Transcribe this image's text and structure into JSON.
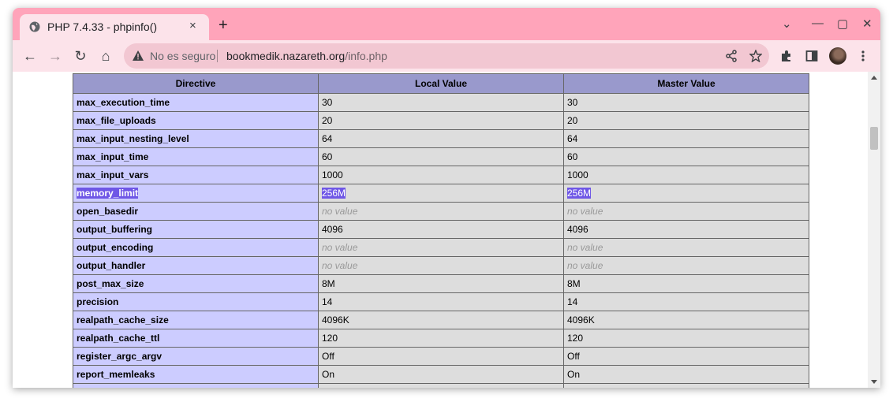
{
  "tab": {
    "title": "PHP 7.4.33 - phpinfo()",
    "close": "×",
    "new_tab": "+"
  },
  "window_controls": {
    "dropdown": "⌄",
    "minimize": "—",
    "maximize": "▢",
    "close": "✕"
  },
  "toolbar": {
    "back": "←",
    "forward": "→",
    "reload": "↻",
    "home": "⌂",
    "security_label": "No es seguro",
    "url_host": "bookmedik.nazareth.org",
    "url_path": "/info.php"
  },
  "table": {
    "headers": [
      "Directive",
      "Local Value",
      "Master Value"
    ],
    "rows": [
      {
        "directive": "max_execution_time",
        "local": "30",
        "master": "30"
      },
      {
        "directive": "max_file_uploads",
        "local": "20",
        "master": "20"
      },
      {
        "directive": "max_input_nesting_level",
        "local": "64",
        "master": "64"
      },
      {
        "directive": "max_input_time",
        "local": "60",
        "master": "60"
      },
      {
        "directive": "max_input_vars",
        "local": "1000",
        "master": "1000"
      },
      {
        "directive": "memory_limit",
        "local": "256M",
        "master": "256M"
      },
      {
        "directive": "open_basedir",
        "local": "no value",
        "master": "no value"
      },
      {
        "directive": "output_buffering",
        "local": "4096",
        "master": "4096"
      },
      {
        "directive": "output_encoding",
        "local": "no value",
        "master": "no value"
      },
      {
        "directive": "output_handler",
        "local": "no value",
        "master": "no value"
      },
      {
        "directive": "post_max_size",
        "local": "8M",
        "master": "8M"
      },
      {
        "directive": "precision",
        "local": "14",
        "master": "14"
      },
      {
        "directive": "realpath_cache_size",
        "local": "4096K",
        "master": "4096K"
      },
      {
        "directive": "realpath_cache_ttl",
        "local": "120",
        "master": "120"
      },
      {
        "directive": "register_argc_argv",
        "local": "Off",
        "master": "Off"
      },
      {
        "directive": "report_memleaks",
        "local": "On",
        "master": "On"
      },
      {
        "directive": "",
        "local": "",
        "master": ""
      }
    ]
  },
  "colors": {
    "tabbar": "#ffa4ba",
    "toolbar": "#fce3ea",
    "header": "#9999cc",
    "directive_cell": "#ccccff",
    "value_cell": "#dddddd",
    "selection": "#6f57e6"
  }
}
